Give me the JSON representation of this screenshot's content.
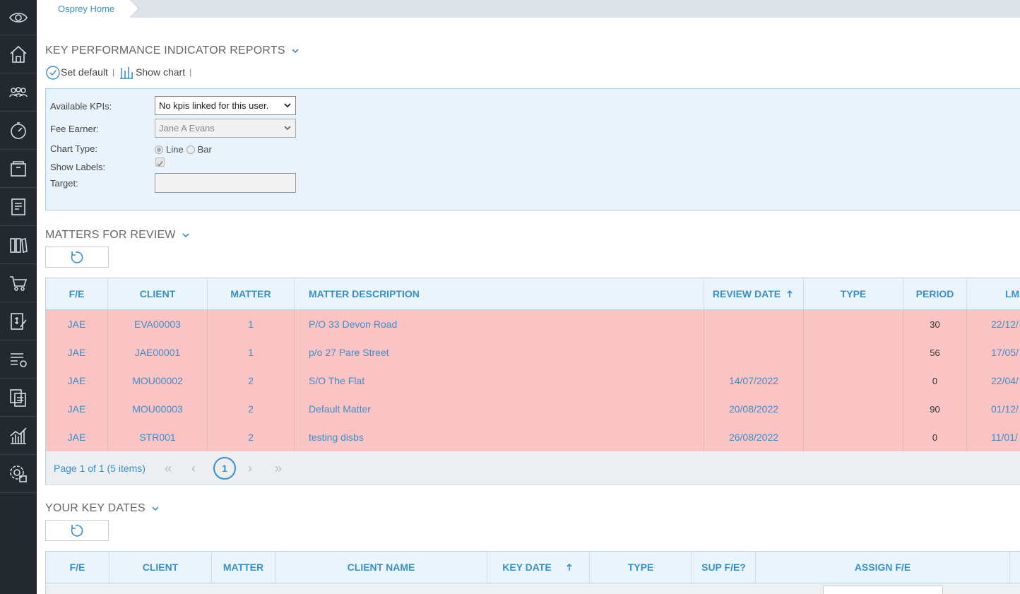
{
  "breadcrumb": {
    "home": "Osprey Home"
  },
  "sidebar": {
    "items": [
      "eye-icon",
      "home-icon",
      "users-icon",
      "gauge-icon",
      "archive-icon",
      "ledger-icon",
      "books-icon",
      "cart-icon",
      "billing-icon",
      "settings-list-icon",
      "documents-icon",
      "reports-chart-icon",
      "admin-gear-icon"
    ]
  },
  "kpi": {
    "title": "KEY PERFORMANCE INDICATOR REPORTS",
    "set_default": "Set default",
    "show_chart": "Show chart",
    "sep": "|",
    "labels": {
      "available": "Available KPIs:",
      "fee_earner": "Fee Earner:",
      "chart_type": "Chart Type:",
      "show_labels": "Show Labels:",
      "target": "Target:"
    },
    "available_value": "No kpis linked for this user.",
    "fee_earner_value": "Jane A Evans",
    "chart_line": "Line",
    "chart_bar": "Bar"
  },
  "review": {
    "title": "MATTERS FOR REVIEW",
    "columns": [
      "F/E",
      "CLIENT",
      "MATTER",
      "MATTER DESCRIPTION",
      "REVIEW DATE",
      "TYPE",
      "PERIOD",
      "LM"
    ],
    "rows": [
      {
        "fe": "JAE",
        "client": "EVA00003",
        "matter": "1",
        "desc": "P/O 33 Devon Road",
        "review": "",
        "type": "",
        "period": "30",
        "lm": "22/12/"
      },
      {
        "fe": "JAE",
        "client": "JAE00001",
        "matter": "1",
        "desc": "p/o 27 Pare Street",
        "review": "",
        "type": "",
        "period": "56",
        "lm": "17/05/"
      },
      {
        "fe": "JAE",
        "client": "MOU00002",
        "matter": "2",
        "desc": "S/O The Flat",
        "review": "14/07/2022",
        "type": "",
        "period": "0",
        "lm": "22/04/"
      },
      {
        "fe": "JAE",
        "client": "MOU00003",
        "matter": "2",
        "desc": "Default Matter",
        "review": "20/08/2022",
        "type": "",
        "period": "90",
        "lm": "01/12/"
      },
      {
        "fe": "JAE",
        "client": "STR001",
        "matter": "2",
        "desc": "testing disbs",
        "review": "26/08/2022",
        "type": "",
        "period": "0",
        "lm": "11/01/"
      }
    ],
    "pager_info": "Page 1 of 1 (5 items)",
    "current_page": "1",
    "nav": {
      "first": "«",
      "prev": "‹",
      "next": "›",
      "last": "»"
    }
  },
  "keydates": {
    "title": "YOUR KEY DATES",
    "columns": [
      "F/E",
      "CLIENT",
      "MATTER",
      "CLIENT NAME",
      "KEY DATE",
      "TYPE",
      "SUP F/E?",
      "ASSIGN F/E"
    ]
  },
  "colors": {
    "accent": "#3b8fc9",
    "sidebar": "#23292f",
    "row_alert": "#fbc4c4",
    "panel": "#e8f3fb"
  }
}
